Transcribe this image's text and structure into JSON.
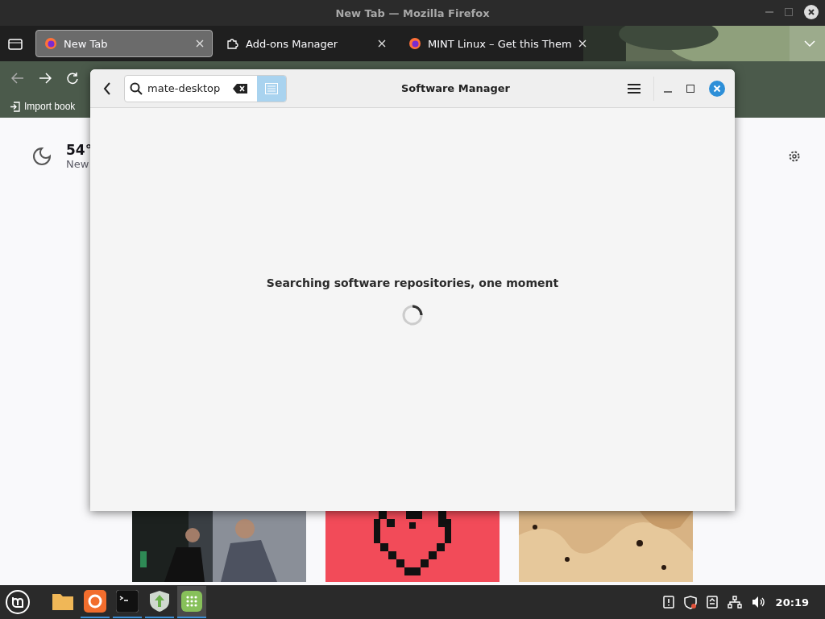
{
  "browser": {
    "title": "New Tab — Mozilla Firefox",
    "tabs": [
      {
        "label": "New Tab",
        "kind": "web",
        "selected": true
      },
      {
        "label": "Add-ons Manager",
        "kind": "addons",
        "selected": false
      },
      {
        "label": "MINT Linux – Get this Them",
        "kind": "web",
        "selected": false
      }
    ],
    "bookmarks_bar": {
      "label": "Import book"
    },
    "weather": {
      "temperature": "54°",
      "location": "New"
    }
  },
  "software_manager": {
    "title": "Software Manager",
    "search": {
      "value": "mate-desktop"
    },
    "message": "Searching software repositories, one moment"
  },
  "taskbar": {
    "apps": [
      {
        "kind": "files",
        "running": false,
        "active": false
      },
      {
        "kind": "firefox",
        "running": true,
        "active": false
      },
      {
        "kind": "terminal",
        "running": true,
        "active": false
      },
      {
        "kind": "update",
        "running": true,
        "active": false
      },
      {
        "kind": "software",
        "running": true,
        "active": true
      }
    ],
    "clock": "20:19"
  }
}
